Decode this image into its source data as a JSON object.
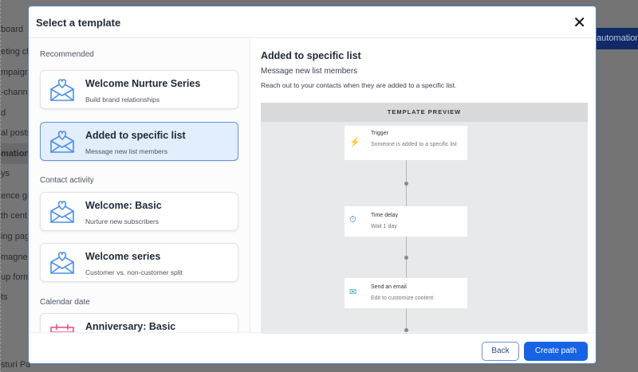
{
  "background": {
    "sidebar_items": [
      "board",
      "eting ch",
      "mpaign",
      "-channe",
      "d",
      "al posts",
      "mations",
      "ys",
      "ence gr",
      "th cent",
      "ing pag",
      "magne",
      "up form",
      "ts",
      "sturi Pa"
    ],
    "active_index": 6,
    "top_button": "automation"
  },
  "modal": {
    "title": "Select a template",
    "close_icon": "close-icon",
    "sections": [
      {
        "label": "Recommended",
        "items": [
          {
            "title": "Welcome Nurture Series",
            "subtitle": "Build brand relationships",
            "icon": "envelope-heart-icon"
          },
          {
            "title": "Added to specific list",
            "subtitle": "Message new list members",
            "icon": "envelope-heart-icon",
            "selected": true
          }
        ]
      },
      {
        "label": "Contact activity",
        "items": [
          {
            "title": "Welcome: Basic",
            "subtitle": "Nurture new subscribers",
            "icon": "envelope-heart-icon"
          },
          {
            "title": "Welcome series",
            "subtitle": "Customer vs. non-customer split",
            "icon": "envelope-heart-icon"
          }
        ]
      },
      {
        "label": "Calendar date",
        "items": [
          {
            "title": "Anniversary: Basic",
            "subtitle": "",
            "icon": "calendar-icon"
          }
        ]
      }
    ],
    "detail": {
      "title": "Added to specific list",
      "subtitle": "Message new list members",
      "description": "Reach out to your contacts when they are added to a specific list.",
      "preview_label": "TEMPLATE PREVIEW",
      "steps": [
        {
          "title": "Trigger",
          "subtitle": "Someone is added to a specific list",
          "icon": "lightning-icon",
          "color": "#f5a623"
        },
        {
          "title": "Time delay",
          "subtitle": "Wait 1 day",
          "icon": "stopwatch-icon",
          "color": "#2f6fd6"
        },
        {
          "title": "Send an email",
          "subtitle": "Edit to customize content",
          "icon": "email-icon",
          "color": "#2a9fb5"
        }
      ]
    },
    "footer": {
      "back": "Back",
      "create": "Create path"
    }
  },
  "colors": {
    "accent": "#1664e5",
    "selected_bg": "#e3eefc",
    "icon_blue": "#4a8ee8",
    "icon_pink": "#e8508a"
  }
}
